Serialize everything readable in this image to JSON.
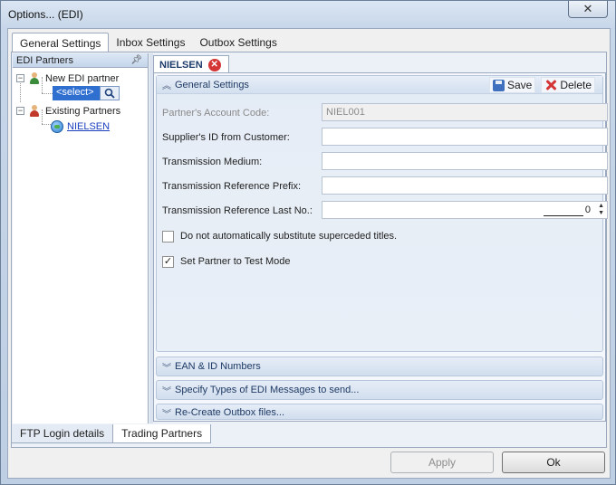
{
  "window": {
    "title": "Options... (EDI)",
    "close_glyph": "✕"
  },
  "top_tabs": [
    {
      "label": "General Settings",
      "active": true
    },
    {
      "label": "Inbox Settings",
      "active": false
    },
    {
      "label": "Outbox Settings",
      "active": false
    }
  ],
  "left_pane": {
    "header": "EDI Partners",
    "tree": {
      "new_partner": "New EDI partner",
      "select_value": "<select>",
      "existing_partners": "Existing Partners",
      "partner_link": "NIELSEN"
    }
  },
  "doc_tab": {
    "label": "NIELSEN"
  },
  "general_settings": {
    "header": "General Settings",
    "save_label": "Save",
    "delete_label": "Delete",
    "fields": {
      "account_code": {
        "label": "Partner's Account Code:",
        "value": "NIEL001"
      },
      "supplier_id": {
        "label": "Supplier's ID from Customer:",
        "value": ""
      },
      "transmission_medium": {
        "label": "Transmission Medium:",
        "value": ""
      },
      "ref_prefix": {
        "label": "Transmission Reference Prefix:",
        "value": ""
      },
      "ref_last_no": {
        "label": "Transmission Reference Last No.:",
        "value": "0"
      }
    },
    "checks": {
      "no_substitute": {
        "label": "Do not automatically substitute superceded titles.",
        "checked": false
      },
      "test_mode": {
        "label": "Set Partner to Test Mode",
        "checked": true
      }
    }
  },
  "collapsed_groups": {
    "ean": "EAN & ID Numbers",
    "message_types": "Specify Types of EDI Messages to send...",
    "recreate": "Re-Create Outbox files..."
  },
  "bottom_tabs": [
    {
      "label": "FTP Login details",
      "active": false
    },
    {
      "label": "Trading Partners",
      "active": true
    }
  ],
  "buttons": {
    "apply": "Apply",
    "ok": "Ok"
  }
}
